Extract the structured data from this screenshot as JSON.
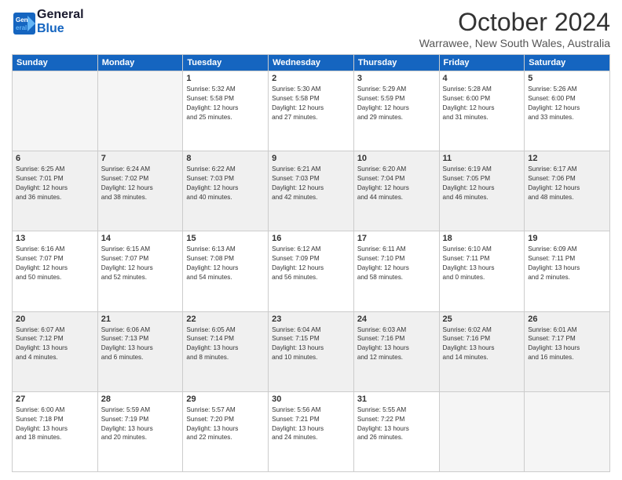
{
  "logo": {
    "line1": "General",
    "line2": "Blue"
  },
  "title": "October 2024",
  "location": "Warrawee, New South Wales, Australia",
  "days_of_week": [
    "Sunday",
    "Monday",
    "Tuesday",
    "Wednesday",
    "Thursday",
    "Friday",
    "Saturday"
  ],
  "weeks": [
    [
      {
        "day": "",
        "detail": ""
      },
      {
        "day": "",
        "detail": ""
      },
      {
        "day": "1",
        "detail": "Sunrise: 5:32 AM\nSunset: 5:58 PM\nDaylight: 12 hours\nand 25 minutes."
      },
      {
        "day": "2",
        "detail": "Sunrise: 5:30 AM\nSunset: 5:58 PM\nDaylight: 12 hours\nand 27 minutes."
      },
      {
        "day": "3",
        "detail": "Sunrise: 5:29 AM\nSunset: 5:59 PM\nDaylight: 12 hours\nand 29 minutes."
      },
      {
        "day": "4",
        "detail": "Sunrise: 5:28 AM\nSunset: 6:00 PM\nDaylight: 12 hours\nand 31 minutes."
      },
      {
        "day": "5",
        "detail": "Sunrise: 5:26 AM\nSunset: 6:00 PM\nDaylight: 12 hours\nand 33 minutes."
      }
    ],
    [
      {
        "day": "6",
        "detail": "Sunrise: 6:25 AM\nSunset: 7:01 PM\nDaylight: 12 hours\nand 36 minutes."
      },
      {
        "day": "7",
        "detail": "Sunrise: 6:24 AM\nSunset: 7:02 PM\nDaylight: 12 hours\nand 38 minutes."
      },
      {
        "day": "8",
        "detail": "Sunrise: 6:22 AM\nSunset: 7:03 PM\nDaylight: 12 hours\nand 40 minutes."
      },
      {
        "day": "9",
        "detail": "Sunrise: 6:21 AM\nSunset: 7:03 PM\nDaylight: 12 hours\nand 42 minutes."
      },
      {
        "day": "10",
        "detail": "Sunrise: 6:20 AM\nSunset: 7:04 PM\nDaylight: 12 hours\nand 44 minutes."
      },
      {
        "day": "11",
        "detail": "Sunrise: 6:19 AM\nSunset: 7:05 PM\nDaylight: 12 hours\nand 46 minutes."
      },
      {
        "day": "12",
        "detail": "Sunrise: 6:17 AM\nSunset: 7:06 PM\nDaylight: 12 hours\nand 48 minutes."
      }
    ],
    [
      {
        "day": "13",
        "detail": "Sunrise: 6:16 AM\nSunset: 7:07 PM\nDaylight: 12 hours\nand 50 minutes."
      },
      {
        "day": "14",
        "detail": "Sunrise: 6:15 AM\nSunset: 7:07 PM\nDaylight: 12 hours\nand 52 minutes."
      },
      {
        "day": "15",
        "detail": "Sunrise: 6:13 AM\nSunset: 7:08 PM\nDaylight: 12 hours\nand 54 minutes."
      },
      {
        "day": "16",
        "detail": "Sunrise: 6:12 AM\nSunset: 7:09 PM\nDaylight: 12 hours\nand 56 minutes."
      },
      {
        "day": "17",
        "detail": "Sunrise: 6:11 AM\nSunset: 7:10 PM\nDaylight: 12 hours\nand 58 minutes."
      },
      {
        "day": "18",
        "detail": "Sunrise: 6:10 AM\nSunset: 7:11 PM\nDaylight: 13 hours\nand 0 minutes."
      },
      {
        "day": "19",
        "detail": "Sunrise: 6:09 AM\nSunset: 7:11 PM\nDaylight: 13 hours\nand 2 minutes."
      }
    ],
    [
      {
        "day": "20",
        "detail": "Sunrise: 6:07 AM\nSunset: 7:12 PM\nDaylight: 13 hours\nand 4 minutes."
      },
      {
        "day": "21",
        "detail": "Sunrise: 6:06 AM\nSunset: 7:13 PM\nDaylight: 13 hours\nand 6 minutes."
      },
      {
        "day": "22",
        "detail": "Sunrise: 6:05 AM\nSunset: 7:14 PM\nDaylight: 13 hours\nand 8 minutes."
      },
      {
        "day": "23",
        "detail": "Sunrise: 6:04 AM\nSunset: 7:15 PM\nDaylight: 13 hours\nand 10 minutes."
      },
      {
        "day": "24",
        "detail": "Sunrise: 6:03 AM\nSunset: 7:16 PM\nDaylight: 13 hours\nand 12 minutes."
      },
      {
        "day": "25",
        "detail": "Sunrise: 6:02 AM\nSunset: 7:16 PM\nDaylight: 13 hours\nand 14 minutes."
      },
      {
        "day": "26",
        "detail": "Sunrise: 6:01 AM\nSunset: 7:17 PM\nDaylight: 13 hours\nand 16 minutes."
      }
    ],
    [
      {
        "day": "27",
        "detail": "Sunrise: 6:00 AM\nSunset: 7:18 PM\nDaylight: 13 hours\nand 18 minutes."
      },
      {
        "day": "28",
        "detail": "Sunrise: 5:59 AM\nSunset: 7:19 PM\nDaylight: 13 hours\nand 20 minutes."
      },
      {
        "day": "29",
        "detail": "Sunrise: 5:57 AM\nSunset: 7:20 PM\nDaylight: 13 hours\nand 22 minutes."
      },
      {
        "day": "30",
        "detail": "Sunrise: 5:56 AM\nSunset: 7:21 PM\nDaylight: 13 hours\nand 24 minutes."
      },
      {
        "day": "31",
        "detail": "Sunrise: 5:55 AM\nSunset: 7:22 PM\nDaylight: 13 hours\nand 26 minutes."
      },
      {
        "day": "",
        "detail": ""
      },
      {
        "day": "",
        "detail": ""
      }
    ]
  ]
}
